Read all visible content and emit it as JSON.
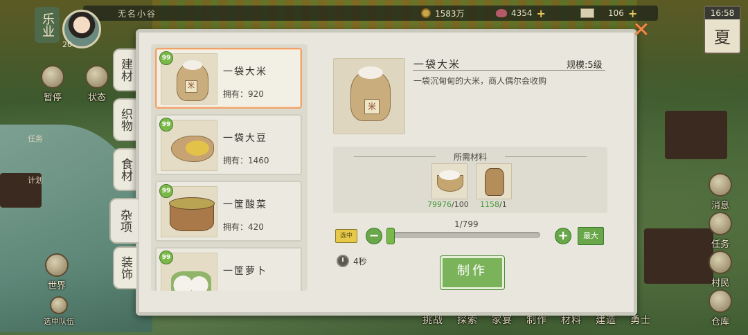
{
  "hud": {
    "app_title": "乐业",
    "village_name": "无名小谷",
    "player_level": "20",
    "copper": "1583万",
    "gems": "4354",
    "tickets": "106",
    "time": "16:58",
    "season": "夏"
  },
  "left_menu": {
    "pause": "暂停",
    "status": "状态",
    "task_tab": "任务",
    "plan_tab": "计划",
    "world": "世界",
    "selected_team": "选中队伍"
  },
  "right_menu": [
    "消息",
    "任务",
    "村民",
    "仓库"
  ],
  "bottom_menu": [
    "挑战",
    "探索",
    "家宴",
    "制作",
    "材料",
    "建造",
    "勇士"
  ],
  "categories": [
    {
      "label": "建材",
      "active": false
    },
    {
      "label": "织物",
      "active": false
    },
    {
      "label": "食材",
      "active": false
    },
    {
      "label": "杂项",
      "active": true
    },
    {
      "label": "装饰",
      "active": false
    }
  ],
  "items": [
    {
      "badge": "99",
      "name": "一袋大米",
      "owned": "拥有：920",
      "selected": true
    },
    {
      "badge": "99",
      "name": "一袋大豆",
      "owned": "拥有：1460",
      "selected": false
    },
    {
      "badge": "99",
      "name": "一筐酸菜",
      "owned": "拥有：420",
      "selected": false
    },
    {
      "badge": "99",
      "name": "一筐萝卜",
      "owned": "",
      "selected": false
    }
  ],
  "detail": {
    "title": "一袋大米",
    "scale": "规模:5级",
    "description": "一袋沉甸甸的大米，商人偶尔会收购",
    "sack_char": "米",
    "materials_title": "所需材料",
    "materials": [
      {
        "icon": "rice-bowl-icon",
        "have": "79976",
        "need": "/100"
      },
      {
        "icon": "burlap-sack-icon",
        "have": "1158",
        "need": "/1"
      }
    ],
    "quantity": "1/799",
    "max_label": "最大",
    "select_badge": "选中",
    "duration": "4秒",
    "make_label": "制作"
  },
  "colors": {
    "accent_green": "#7ab35a",
    "selected_border": "#f0a26a",
    "close_orange": "#f28a4a"
  }
}
